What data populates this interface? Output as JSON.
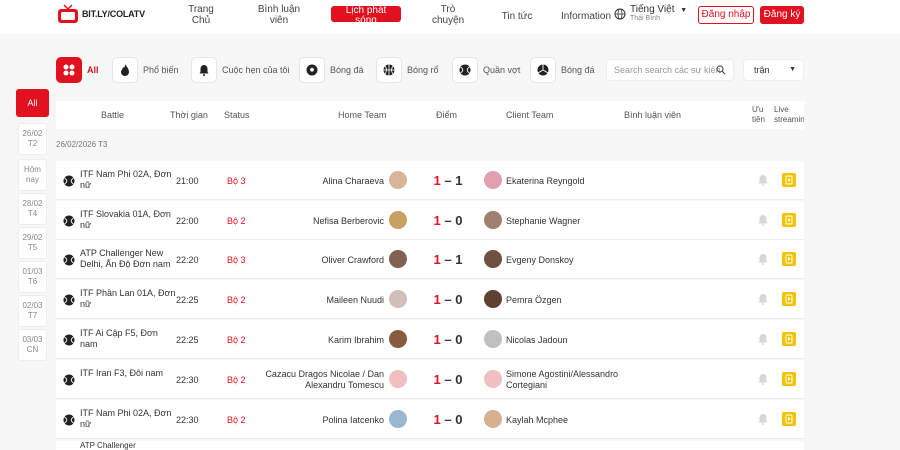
{
  "header": {
    "logo_text": "BIT.LY/COLATV",
    "nav": [
      {
        "label": "Trang\nChủ"
      },
      {
        "label": "Bình luận\nviên"
      },
      {
        "label": "Lịch phát\nsóng"
      },
      {
        "label": "Trò\nchuyện"
      },
      {
        "label": "Tin tức"
      },
      {
        "label": "Information"
      }
    ],
    "language": "Tiếng Việt",
    "language_sub": "Thái Bình",
    "login": "Đăng nhập",
    "register": "Đăng ký"
  },
  "filters": {
    "all": "All",
    "popular": "Phổ biến",
    "my_bookings": "Cuộc hẹn của tôi",
    "football": "Bóng đá",
    "basketball": "Bóng rổ",
    "tennis": "Quần vợt",
    "volleyball": "Bóng đá",
    "search_placeholder": "Search search các sự kiện",
    "select_value": "trận"
  },
  "dates": {
    "all": "All",
    "items": [
      {
        "line1": "26/02",
        "line2": "T2"
      },
      {
        "line1": "Hôm",
        "line2": "nay"
      },
      {
        "line1": "28/02",
        "line2": "T4"
      },
      {
        "line1": "29/02",
        "line2": "T5"
      },
      {
        "line1": "01/03",
        "line2": "T6"
      },
      {
        "line1": "02/03",
        "line2": "T7"
      },
      {
        "line1": "03/03",
        "line2": "CN"
      }
    ]
  },
  "table": {
    "headers": {
      "battle": "Battle",
      "time": "Thời gian",
      "status": "Status",
      "home": "Home Team",
      "score": "Điểm",
      "away": "Client Team",
      "commentator": "Bình luận viên",
      "fav": "Ưu tiên",
      "live": "Live streaming"
    },
    "date_label": "26/02/2026 T3",
    "rows": [
      {
        "league": "ITF Nam Phi 02A, Đơn nữ",
        "time": "21:00",
        "status": "Bộ 3",
        "home": "Alina Charaeva",
        "score_home": "1",
        "score_away": "1",
        "away": "Ekaterina Reyngold",
        "home_color": "#d7b59a",
        "away_color": "#e0a0b0"
      },
      {
        "league": "ITF Slovakia 01A, Đơn nữ",
        "time": "22:00",
        "status": "Bộ 2",
        "home": "Nefisa Berberovic",
        "score_home": "1",
        "score_away": "0",
        "away": "Stephanie Wagner",
        "home_color": "#c9a060",
        "away_color": "#a08070"
      },
      {
        "league": "ATP Challenger New Delhi, Ấn Độ Đơn nam",
        "time": "22:20",
        "status": "Bộ 3",
        "home": "Oliver Crawford",
        "score_home": "1",
        "score_away": "1",
        "away": "Evgeny Donskoy",
        "home_color": "#806050",
        "away_color": "#705040"
      },
      {
        "league": "ITF Phần Lan 01A, Đơn nữ",
        "time": "22:25",
        "status": "Bộ 2",
        "home": "Maileen Nuudi",
        "score_home": "1",
        "score_away": "0",
        "away": "Pemra Özgen",
        "home_color": "#d0c0b8",
        "away_color": "#604030"
      },
      {
        "league": "ITF Ai Cập F5, Đơn nam",
        "time": "22:25",
        "status": "Bộ 2",
        "home": "Karim Ibrahim",
        "score_home": "1",
        "score_away": "0",
        "away": "Nicolas Jadoun",
        "home_color": "#8a5a40",
        "away_color": "#c0c0c0"
      },
      {
        "league": "ITF Iran F3, Đôi nam",
        "time": "22:30",
        "status": "Bộ 2",
        "home": "Cazacu Dragos Nicolae / Dan Alexandru Tomescu",
        "score_home": "1",
        "score_away": "0",
        "away": "Simone Agostini/Alessandro Cortegiani",
        "home_color": "#f0c0c0",
        "away_color": "#f0c0c0"
      },
      {
        "league": "ITF Nam Phi 02A, Đơn nữ",
        "time": "22:30",
        "status": "Bộ 2",
        "home": "Polina Iatcenko",
        "score_home": "1",
        "score_away": "0",
        "away": "Kaylah Mcphee",
        "home_color": "#9ab8d0",
        "away_color": "#d8b090"
      }
    ],
    "partial_row_league": "ATP Challenger"
  },
  "colors": {
    "accent": "#e1111f",
    "live": "#f3c200"
  }
}
